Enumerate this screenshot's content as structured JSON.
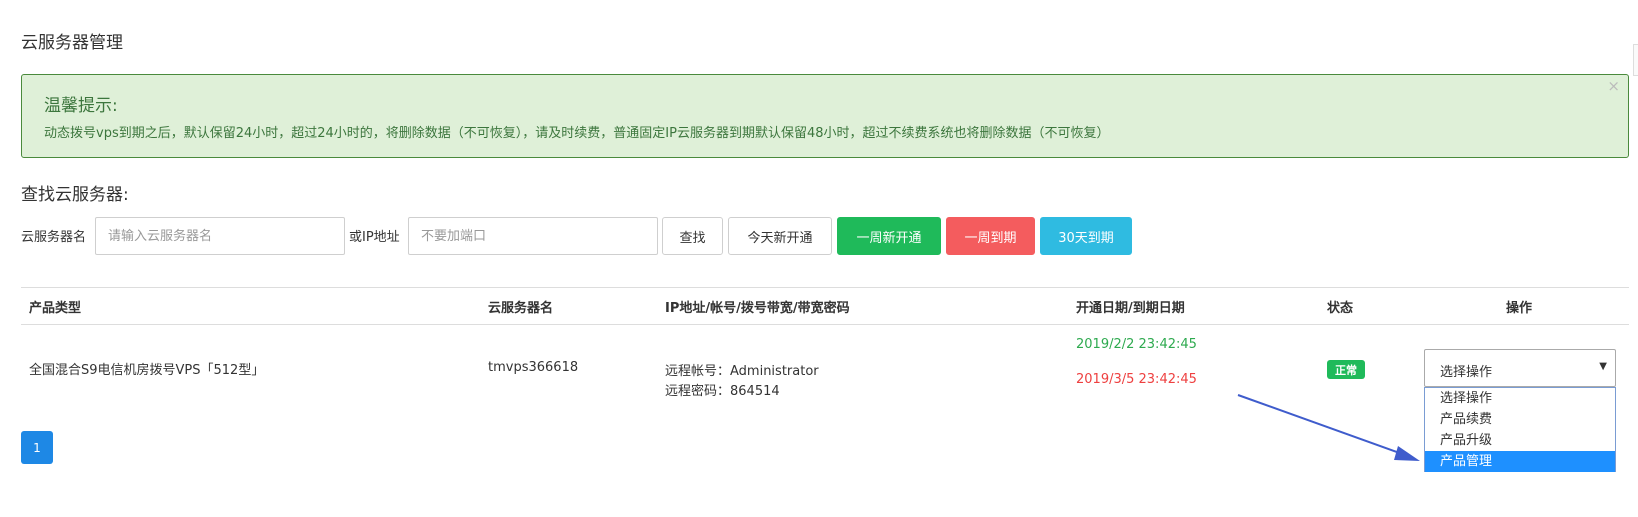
{
  "page": {
    "title": "云服务器管理"
  },
  "alert": {
    "title": "温馨提示:",
    "text": "动态拨号vps到期之后，默认保留24小时，超过24小时的，将删除数据（不可恢复），请及时续费，普通固定IP云服务器到期默认保留48小时，超过不续费系统也将删除数据（不可恢复）",
    "close": "×"
  },
  "search": {
    "title": "查找云服务器:",
    "name_label": "云服务器名",
    "name_placeholder": "请输入云服务器名",
    "ip_label": "或IP地址",
    "ip_placeholder": "不要加端口",
    "buttons": {
      "search": "查找",
      "today": "今天新开通",
      "week_open": "一周新开通",
      "week_expire": "一周到期",
      "month_expire": "30天到期"
    }
  },
  "table": {
    "headers": [
      "产品类型",
      "云服务器名",
      "IP地址/帐号/拨号带宽/带宽密码",
      "开通日期/到期日期",
      "状态",
      "操作"
    ],
    "rows": [
      {
        "type": "全国混合S9电信机房拨号VPS「512型」",
        "name": "tmvps366618",
        "account": "远程帐号：Administrator",
        "password": "远程密码：864514",
        "open_date": "2019/2/2 23:42:45",
        "expire_date": "2019/3/5 23:42:45",
        "status": "正常",
        "action": {
          "value": "选择操作",
          "caret": "▼",
          "options": [
            "选择操作",
            "产品续费",
            "产品升级",
            "产品管理"
          ],
          "highlighted": "产品管理"
        }
      }
    ]
  },
  "pagination": {
    "current": "1"
  },
  "colors": {
    "alert_bg": "#dff0d8",
    "alert_text": "#3c763d",
    "green": "#1fba5a",
    "red": "#f45c5e",
    "cyan": "#2fbbe1",
    "blue": "#1e88e5",
    "arrow": "#3f5ccc"
  }
}
